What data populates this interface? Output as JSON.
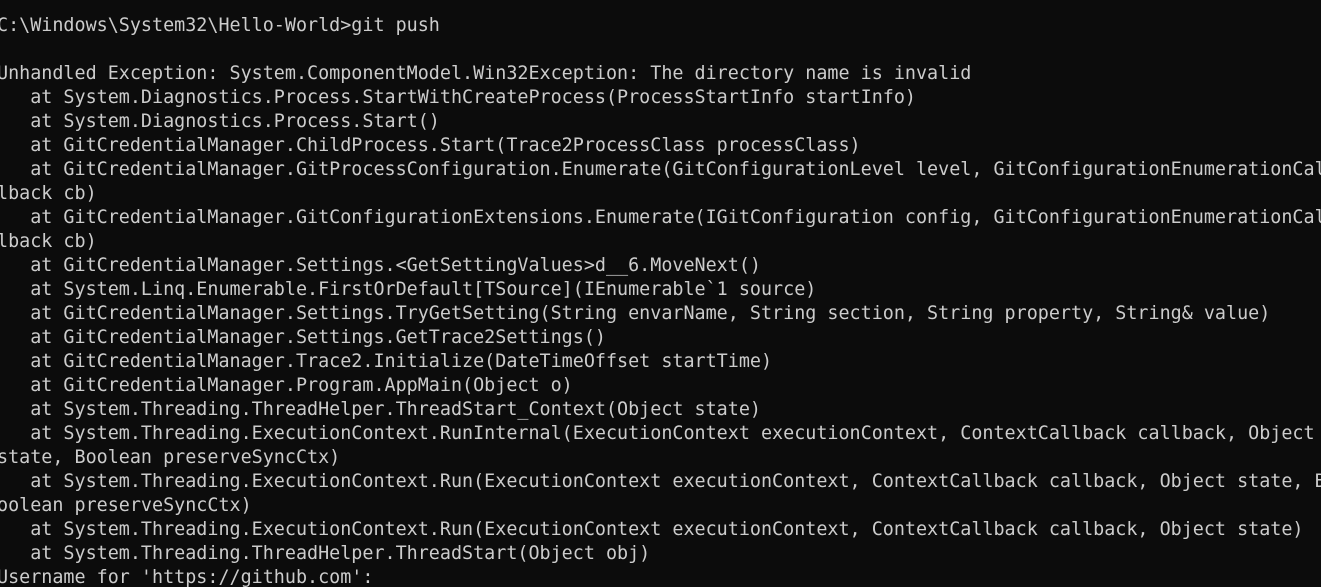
{
  "terminal": {
    "lines": [
      "C:\\Windows\\System32\\Hello-World>git push",
      "",
      "Unhandled Exception: System.ComponentModel.Win32Exception: The directory name is invalid",
      "   at System.Diagnostics.Process.StartWithCreateProcess(ProcessStartInfo startInfo)",
      "   at System.Diagnostics.Process.Start()",
      "   at GitCredentialManager.ChildProcess.Start(Trace2ProcessClass processClass)",
      "   at GitCredentialManager.GitProcessConfiguration.Enumerate(GitConfigurationLevel level, GitConfigurationEnumerationCal",
      "lback cb)",
      "   at GitCredentialManager.GitConfigurationExtensions.Enumerate(IGitConfiguration config, GitConfigurationEnumerationCal",
      "lback cb)",
      "   at GitCredentialManager.Settings.<GetSettingValues>d__6.MoveNext()",
      "   at System.Linq.Enumerable.FirstOrDefault[TSource](IEnumerable`1 source)",
      "   at GitCredentialManager.Settings.TryGetSetting(String envarName, String section, String property, String& value)",
      "   at GitCredentialManager.Settings.GetTrace2Settings()",
      "   at GitCredentialManager.Trace2.Initialize(DateTimeOffset startTime)",
      "   at GitCredentialManager.Program.AppMain(Object o)",
      "   at System.Threading.ThreadHelper.ThreadStart_Context(Object state)",
      "   at System.Threading.ExecutionContext.RunInternal(ExecutionContext executionContext, ContextCallback callback, Object",
      "state, Boolean preserveSyncCtx)",
      "   at System.Threading.ExecutionContext.Run(ExecutionContext executionContext, ContextCallback callback, Object state, B",
      "oolean preserveSyncCtx)",
      "   at System.Threading.ExecutionContext.Run(ExecutionContext executionContext, ContextCallback callback, Object state)",
      "   at System.Threading.ThreadHelper.ThreadStart(Object obj)",
      "Username for 'https://github.com':"
    ]
  },
  "colors": {
    "background": "#0c0c0c",
    "foreground": "#cccccc"
  }
}
